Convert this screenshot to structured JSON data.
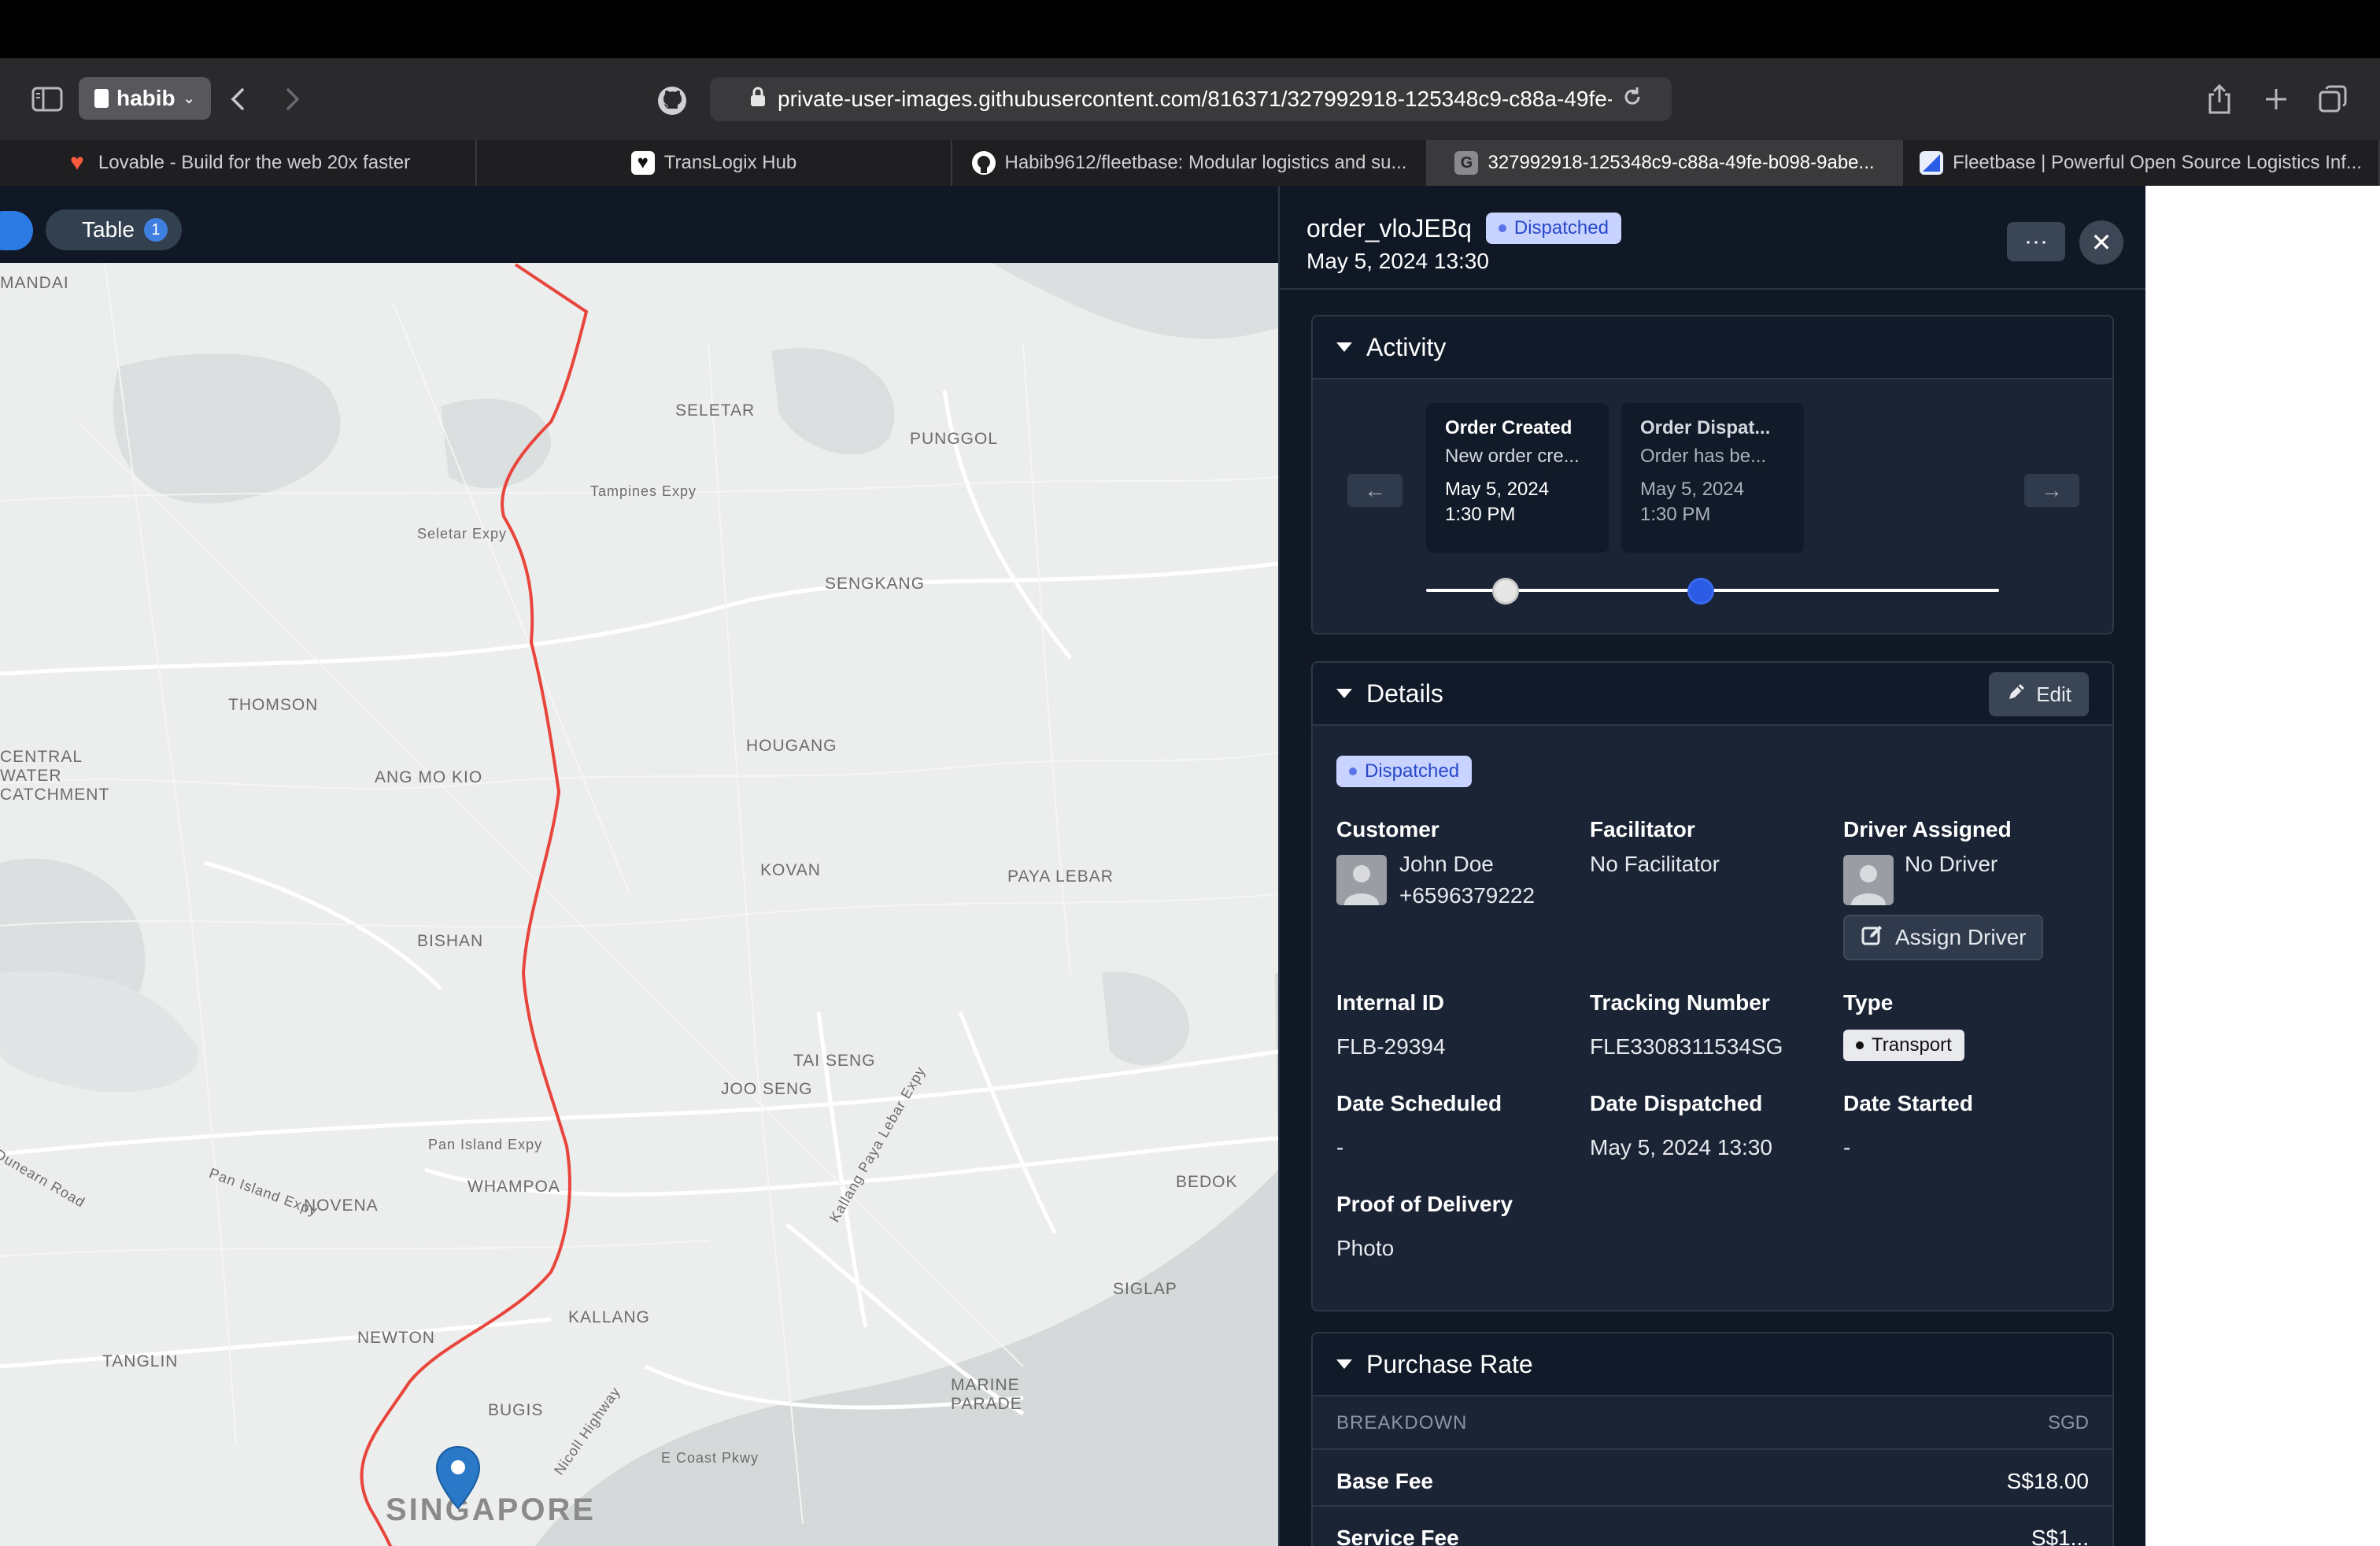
{
  "browser": {
    "profile_name": "habib",
    "url": "private-user-images.githubusercontent.com/816371/327992918-125348c9-c88a-49fe-",
    "tabs": [
      {
        "label": "Lovable - Build for the web 20x faster",
        "icon": "heart-icon",
        "active": false
      },
      {
        "label": "TransLogix Hub",
        "icon": "heart-outline-icon",
        "active": false
      },
      {
        "label": "Habib9612/fleetbase: Modular logistics and su...",
        "icon": "github-icon",
        "active": false
      },
      {
        "label": "327992918-125348c9-c88a-49fe-b098-9abe...",
        "icon": "g-icon",
        "active": true
      },
      {
        "label": "Fleetbase | Powerful Open Source Logistics Inf...",
        "icon": "fleetbase-icon",
        "active": false
      }
    ],
    "favicon_letters": {
      "g": "G"
    }
  },
  "map": {
    "table_label": "Table",
    "table_count": "1",
    "labels": [
      "MANDAI",
      "SELETAR",
      "PUNGGOL",
      "Tampines Expy",
      "Seletar Expy",
      "SENGKANG",
      "THOMSON",
      "HOUGANG",
      "ANG MO KIO",
      "CENTRAL",
      "WATER",
      "CATCHMENT",
      "KOVAN",
      "PAYA LEBAR",
      "BISHAN",
      "TAI SENG",
      "JOO SENG",
      "Pan Island Expy",
      "WHAMPOA",
      "NOVENA",
      "BEDOK",
      "KALLANG",
      "SIGLAP",
      "NEWTON",
      "TANGLIN",
      "BUGIS",
      "MARINE",
      "PARADE",
      "E Coast Pkwy",
      "SINGAPORE",
      "Dunearn Road",
      "Pan Island Expy",
      "Kallang Paya Lebar Expy",
      "Nicoll Highway"
    ]
  },
  "order": {
    "id": "order_vloJEBq",
    "status": "Dispatched",
    "datetime": "May 5, 2024 13:30",
    "more_label": "···",
    "close_label": "✕"
  },
  "activity": {
    "title": "Activity",
    "prev_label": "←",
    "next_label": "→",
    "items": [
      {
        "title": "Order Created",
        "desc": "New order cre...",
        "date": "May 5, 2024",
        "time": "1:30 PM"
      },
      {
        "title": "Order Dispat...",
        "desc": "Order has be...",
        "date": "May 5, 2024",
        "time": "1:30 PM"
      }
    ]
  },
  "details": {
    "title": "Details",
    "edit_label": "Edit",
    "status": "Dispatched",
    "customer_label": "Customer",
    "customer_name": "John Doe",
    "customer_phone": "+6596379222",
    "facilitator_label": "Facilitator",
    "facilitator_value": "No Facilitator",
    "driver_label": "Driver Assigned",
    "driver_value": "No Driver",
    "assign_driver_label": "Assign Driver",
    "internal_id_label": "Internal ID",
    "internal_id_value": "FLB-29394",
    "tracking_label": "Tracking Number",
    "tracking_value": "FLE3308311534SG",
    "type_label": "Type",
    "type_value": "Transport",
    "scheduled_label": "Date Scheduled",
    "scheduled_value": "-",
    "dispatched_label": "Date Dispatched",
    "dispatched_value": "May 5, 2024 13:30",
    "started_label": "Date Started",
    "started_value": "-",
    "pod_label": "Proof of Delivery",
    "pod_value": "Photo"
  },
  "purchase_rate": {
    "title": "Purchase Rate",
    "breakdown_label": "BREAKDOWN",
    "currency": "SGD",
    "rows": [
      {
        "label": "Base Fee",
        "value": "S$18.00"
      },
      {
        "label": "Service Fee",
        "value": "S$1..."
      }
    ]
  },
  "colors": {
    "panel_bg": "#101826",
    "card_bg": "#1a2435",
    "accent": "#2c7be5",
    "route": "#e8453c",
    "pin": "#2a78c8"
  }
}
